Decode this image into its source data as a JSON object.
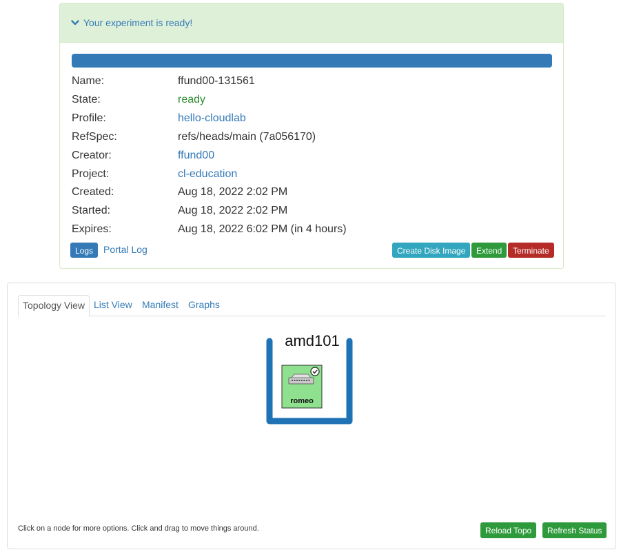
{
  "status": {
    "header_text": "Your experiment is ready!",
    "progress_percent": 100,
    "colors": {
      "progress": "#337ab7",
      "header_bg": "#dff0d8"
    },
    "rows": [
      {
        "label": "Name:",
        "value": "ffund00-131561",
        "style": "plain"
      },
      {
        "label": "State:",
        "value": "ready",
        "style": "ok"
      },
      {
        "label": "Profile:",
        "value": "hello-cloudlab",
        "style": "link"
      },
      {
        "label": "RefSpec:",
        "value": "refs/heads/main (7a056170)",
        "style": "plain"
      },
      {
        "label": "Creator:",
        "value": "ffund00",
        "style": "link"
      },
      {
        "label": "Project:",
        "value": "cl-education",
        "style": "link"
      },
      {
        "label": "Created:",
        "value": "Aug 18, 2022 2:02 PM",
        "style": "plain"
      },
      {
        "label": "Started:",
        "value": "Aug 18, 2022 2:02 PM",
        "style": "plain"
      },
      {
        "label": "Expires:",
        "value": "Aug 18, 2022 6:02 PM (in 4 hours)",
        "style": "plain"
      }
    ],
    "buttons": {
      "logs": "Logs",
      "portal_log": "Portal Log",
      "create_disk_image": "Create Disk Image",
      "extend": "Extend",
      "terminate": "Terminate"
    },
    "button_colors": {
      "logs": "#337ab7",
      "create_disk_image": "#31a6be",
      "extend": "#2e9a3b",
      "terminate": "#b52b27"
    }
  },
  "topology": {
    "tabs": [
      "Topology View",
      "List View",
      "Manifest",
      "Graphs"
    ],
    "active_tab": "Topology View",
    "site_label": "amd101",
    "node": {
      "name": "romeo",
      "status_icon": "check-circle-icon",
      "color": "#8fe08f"
    },
    "hint": "Click on a node for more options. Click and drag to move things around.",
    "buttons": {
      "reload_topo": "Reload Topo",
      "refresh_status": "Refresh Status"
    },
    "colors": {
      "site_frame": "#1f72b4",
      "button": "#2e9a3b"
    }
  }
}
